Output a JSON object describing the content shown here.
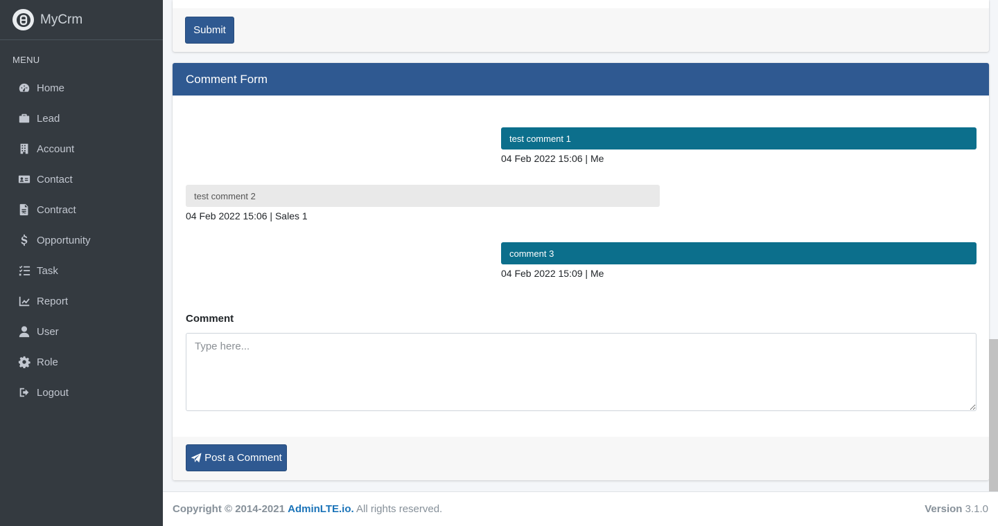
{
  "brand": {
    "name": "MyCrm",
    "logo_icon": "crm-logo-icon"
  },
  "sidebar": {
    "header": "MENU",
    "items": [
      {
        "label": "Home",
        "icon": "dashboard-icon"
      },
      {
        "label": "Lead",
        "icon": "briefcase-icon"
      },
      {
        "label": "Account",
        "icon": "building-icon"
      },
      {
        "label": "Contact",
        "icon": "address-card-icon"
      },
      {
        "label": "Contract",
        "icon": "file-contract-icon"
      },
      {
        "label": "Opportunity",
        "icon": "dollar-icon"
      },
      {
        "label": "Task",
        "icon": "tasks-icon"
      },
      {
        "label": "Report",
        "icon": "chart-line-icon"
      },
      {
        "label": "User",
        "icon": "user-icon"
      },
      {
        "label": "Role",
        "icon": "gear-icon"
      },
      {
        "label": "Logout",
        "icon": "logout-icon"
      }
    ]
  },
  "top_card": {
    "submit_label": "Submit"
  },
  "comment_card": {
    "title": "Comment Form",
    "messages": [
      {
        "text": "test comment 1",
        "meta": "04 Feb 2022 15:06 | Me",
        "side": "right"
      },
      {
        "text": "test comment 2",
        "meta": "04 Feb 2022 15:06 | Sales 1",
        "side": "left"
      },
      {
        "text": "comment 3",
        "meta": "04 Feb 2022 15:09 | Me",
        "side": "right"
      }
    ],
    "comment_label": "Comment",
    "comment_placeholder": "Type here...",
    "comment_value": "",
    "post_label": "Post a Comment"
  },
  "footer": {
    "copyright_prefix": "Copyright © 2014-2021",
    "link_text": "AdminLTE.io.",
    "rights": "All rights reserved.",
    "version_label": "Version",
    "version_value": "3.1.0"
  },
  "colors": {
    "sidebar": "#343a40",
    "primary": "#2f5991",
    "bubble_self": "#0c6f8c",
    "bubble_other": "#e9e9e9"
  }
}
